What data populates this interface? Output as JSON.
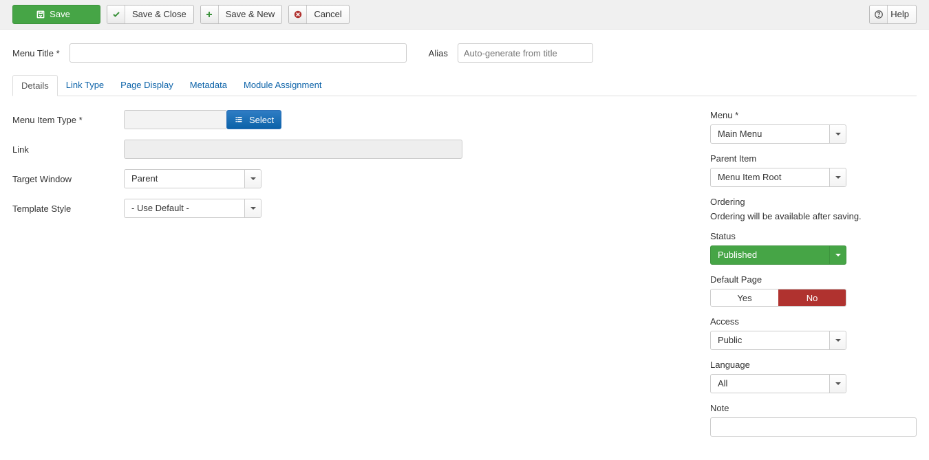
{
  "toolbar": {
    "save": "Save",
    "save_close": "Save & Close",
    "save_new": "Save & New",
    "cancel": "Cancel",
    "help": "Help"
  },
  "title_row": {
    "menu_title_label": "Menu Title *",
    "menu_title_value": "",
    "alias_label": "Alias",
    "alias_placeholder": "Auto-generate from title",
    "alias_value": ""
  },
  "tabs": {
    "details": "Details",
    "link_type": "Link Type",
    "page_display": "Page Display",
    "metadata": "Metadata",
    "module_assignment": "Module Assignment"
  },
  "left": {
    "menu_item_type_label": "Menu Item Type *",
    "menu_item_type_value": "",
    "select_button": "Select",
    "link_label": "Link",
    "link_value": "",
    "target_window_label": "Target Window",
    "target_window_value": "Parent",
    "template_style_label": "Template Style",
    "template_style_value": "- Use Default -"
  },
  "right": {
    "menu_label": "Menu *",
    "menu_value": "Main Menu",
    "parent_item_label": "Parent Item",
    "parent_item_value": "Menu Item Root",
    "ordering_label": "Ordering",
    "ordering_note": "Ordering will be available after saving.",
    "status_label": "Status",
    "status_value": "Published",
    "default_page_label": "Default Page",
    "default_page_yes": "Yes",
    "default_page_no": "No",
    "access_label": "Access",
    "access_value": "Public",
    "language_label": "Language",
    "language_value": "All",
    "note_label": "Note",
    "note_value": ""
  }
}
